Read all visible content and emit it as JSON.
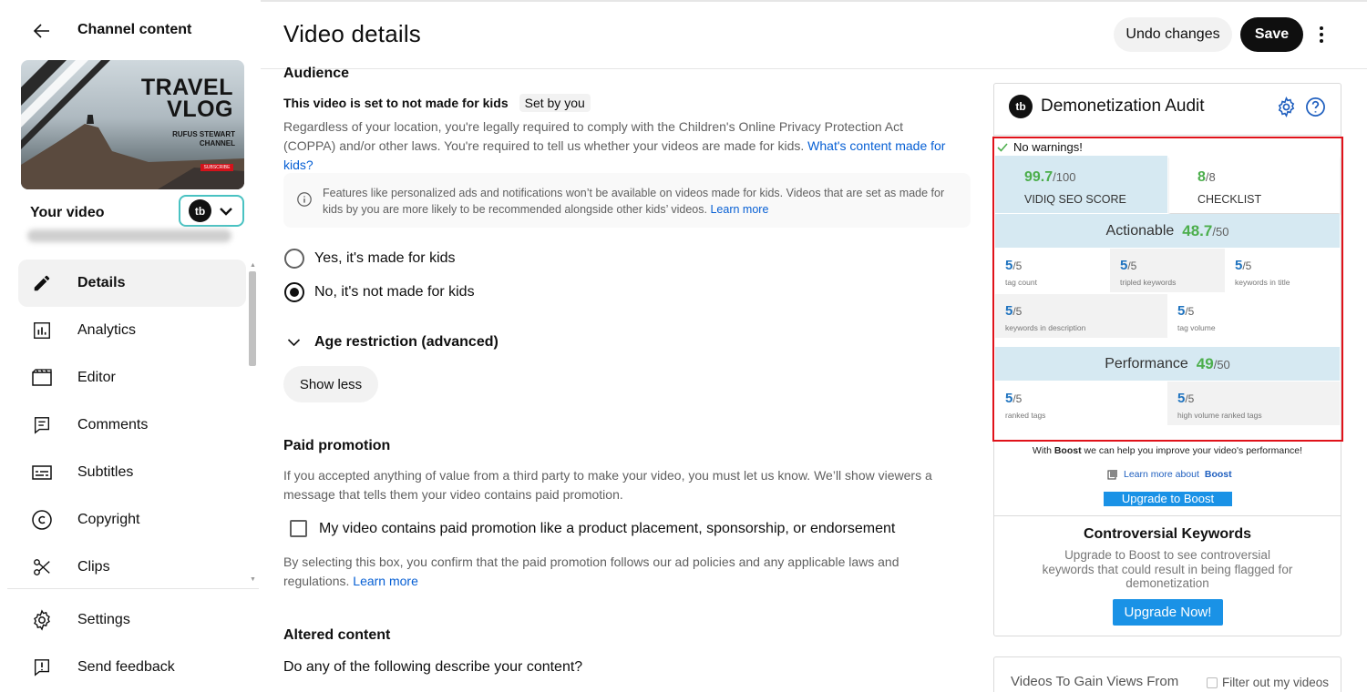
{
  "sidebar": {
    "title": "Channel content",
    "thumbnail": {
      "title_line1": "TRAVEL",
      "title_line2": "VLOG",
      "creator_line1": "RUFUS STEWART",
      "creator_line2": "CHANNEL",
      "subscribe": "SUBSCRIBE"
    },
    "your_video_label": "Your video",
    "nav": [
      {
        "label": "Details",
        "icon": "pencil-icon",
        "active": true
      },
      {
        "label": "Analytics",
        "icon": "analytics-icon"
      },
      {
        "label": "Editor",
        "icon": "editor-icon"
      },
      {
        "label": "Comments",
        "icon": "comments-icon"
      },
      {
        "label": "Subtitles",
        "icon": "subtitles-icon"
      },
      {
        "label": "Copyright",
        "icon": "copyright-icon"
      },
      {
        "label": "Clips",
        "icon": "scissors-icon"
      }
    ],
    "footer": [
      {
        "label": "Settings",
        "icon": "gear-icon"
      },
      {
        "label": "Send feedback",
        "icon": "feedback-icon"
      }
    ]
  },
  "header": {
    "title": "Video details",
    "undo_label": "Undo changes",
    "save_label": "Save"
  },
  "audience": {
    "heading": "Audience",
    "kids_status": "This video is set to not made for kids",
    "set_by_chip": "Set by you",
    "coppa_text": "Regardless of your location, you're legally required to comply with the Children's Online Privacy Protection Act (COPPA) and/or other laws. You're required to tell us whether your videos are made for kids.",
    "coppa_link": "What's content made for kids?",
    "info_text": "Features like personalized ads and notifications won’t be available on videos made for kids. Videos that are set as made for kids by you are more likely to be recommended alongside other kids’ videos.",
    "info_link": "Learn more",
    "option_yes": "Yes, it's made for kids",
    "option_no": "No, it's not made for kids",
    "selected": "no"
  },
  "age_restriction": {
    "label": "Age restriction (advanced)"
  },
  "show_less_label": "Show less",
  "paid_promotion": {
    "heading": "Paid promotion",
    "text": "If you accepted anything of value from a third party to make your video, you must let us know. We’ll show viewers a message that tells them your video contains paid promotion.",
    "checkbox_label": "My video contains paid promotion like a product placement, sponsorship, or endorsement",
    "note": "By selecting this box, you confirm that the paid promotion follows our ad policies and any applicable laws and regulations.",
    "note_link": "Learn more"
  },
  "altered_content": {
    "heading": "Altered content",
    "question": "Do any of the following describe your content?"
  },
  "vidiq": {
    "title": "Demonetization Audit",
    "no_warnings": "No warnings!",
    "seo_score": "99.7",
    "seo_max": "/100",
    "seo_label": "VIDIQ SEO SCORE",
    "checklist_score": "8",
    "checklist_max": "/8",
    "checklist_label": "CHECKLIST",
    "actionable_label": "Actionable",
    "actionable_score": "48.7",
    "actionable_max": "/50",
    "actionable_items": [
      {
        "value": "5",
        "max": "/5",
        "label": "tag count"
      },
      {
        "value": "5",
        "max": "/5",
        "label": "tripled keywords"
      },
      {
        "value": "5",
        "max": "/5",
        "label": "keywords in title"
      },
      {
        "value": "5",
        "max": "/5",
        "label": "keywords in description"
      },
      {
        "value": "5",
        "max": "/5",
        "label": "tag volume"
      }
    ],
    "performance_label": "Performance",
    "performance_score": "49",
    "performance_max": "/50",
    "performance_items": [
      {
        "value": "5",
        "max": "/5",
        "label": "ranked tags"
      },
      {
        "value": "5",
        "max": "/5",
        "label": "high volume ranked tags"
      }
    ],
    "boost_text_pre": "With",
    "boost_text_bold": "Boost",
    "boost_text_post": "we can help you improve your video's performance!",
    "boost_link_pre": "Learn more about",
    "boost_link_bold": "Boost",
    "boost_button": "Upgrade to Boost",
    "controversial_title": "Controversial Keywords",
    "controversial_text": "Upgrade to Boost to see controversial keywords that could result in being flagged for demonetization",
    "upgrade_now": "Upgrade Now!",
    "videos_gain_title": "Videos To Gain Views From",
    "filter_label": "Filter out my videos",
    "colors": {
      "green": "#4cae4c",
      "blue": "#1f73bf",
      "band": "#d6e9f2",
      "button": "#1a92e6",
      "highlight": "#e0121a"
    }
  }
}
